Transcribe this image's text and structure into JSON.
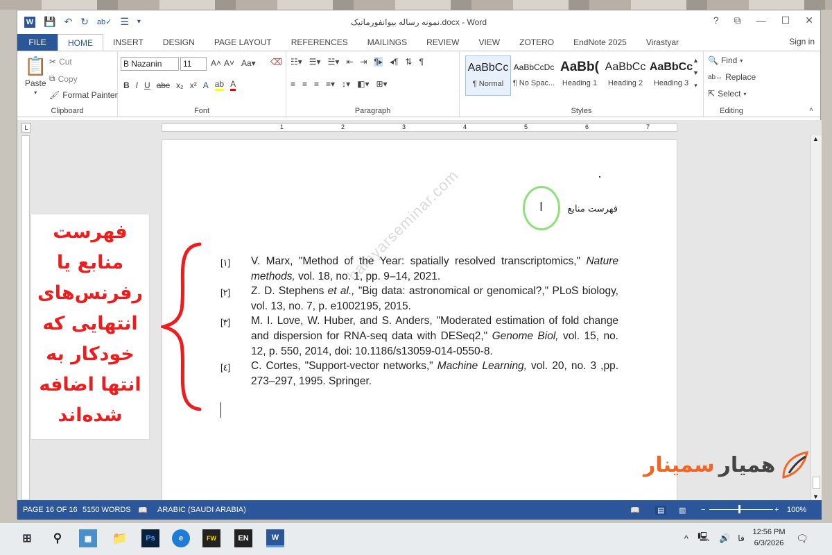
{
  "window": {
    "title": "نمونه رساله بیوانفورماتیک.docx - Word",
    "controls": [
      "?",
      "⧉",
      "—",
      "☐",
      "✕"
    ],
    "sign_in": "Sign in"
  },
  "tabs": [
    "FILE",
    "HOME",
    "INSERT",
    "DESIGN",
    "PAGE LAYOUT",
    "REFERENCES",
    "MAILINGS",
    "REVIEW",
    "VIEW",
    "ZOTERO",
    "EndNote 2025",
    "Virastyar"
  ],
  "ribbon": {
    "clipboard": {
      "paste": "Paste",
      "cut": "Cut",
      "copy": "Copy",
      "format_painter": "Format Painter",
      "label": "Clipboard"
    },
    "font": {
      "name": "B Nazanin",
      "size": "11",
      "label": "Font"
    },
    "paragraph": {
      "label": "Paragraph"
    },
    "styles": {
      "label": "Styles",
      "items": [
        {
          "preview": "AaBbCc",
          "name": "¶ Normal"
        },
        {
          "preview": "AaBbCcDc",
          "name": "¶ No Spac..."
        },
        {
          "preview": "AaBb(",
          "name": "Heading 1"
        },
        {
          "preview": "AaBbCc",
          "name": "Heading 2"
        },
        {
          "preview": "AaBbCc",
          "name": "Heading 3"
        }
      ]
    },
    "editing": {
      "find": "Find",
      "replace": "Replace",
      "select": "Select",
      "label": "Editing"
    }
  },
  "ruler": {
    "numbers": [
      "1",
      "2",
      "3",
      "4",
      "5",
      "6",
      "7"
    ]
  },
  "document": {
    "heading": "فهرست منابع",
    "watermark": "hamyarseminar.com",
    "references": [
      {
        "num": "[۱]",
        "pre": "V. Marx, \"Method of the Year: spatially resolved transcriptomics,\" ",
        "journal": "Nature methods,",
        "post": " vol. 18, no. 1, pp. 9–14, 2021."
      },
      {
        "num": "[۲]",
        "pre": "Z. D. Stephens ",
        "journal": "et al.,",
        "post": " \"Big data: astronomical or genomical?,\" PLoS biology, vol. 13, no. 7, p. e1002195, 2015."
      },
      {
        "num": "[۳]",
        "pre": "M. I. Love, W. Huber, and S. Anders, \"Moderated estimation of fold change and dispersion for RNA-seq data with DESeq2,\" ",
        "journal": "Genome Biol,",
        "post": " vol. 15, no. 12, p. 550, 2014, doi: 10.1186/s13059-014-0550-8."
      },
      {
        "num": "[٤]",
        "pre": "C. Cortes, \"Support-vector networks,\" ",
        "journal": "Machine Learning,",
        "post": " vol. 20, no. 3 ,pp. 273–297, 1995. Springer."
      }
    ]
  },
  "callout": {
    "text": "فهرست منابع یا رفرنس‌های انتهایی که خودکار به انتها اضافه شده‌اند"
  },
  "logo": {
    "word1": "همیار",
    "word2": "سمینار"
  },
  "statusbar": {
    "page": "PAGE 16 OF 16",
    "words": "5150 WORDS",
    "language": "ARABIC (SAUDI ARABIA)",
    "zoom": "100%"
  },
  "taskbar": {
    "time": "12:56 PM",
    "date": "6/3/2026",
    "lang": "فا",
    "apps": [
      "Ps",
      "EN",
      "W"
    ]
  },
  "colors": {
    "word_blue": "#2b579a",
    "callout_red": "#ee1c1c",
    "logo_orange": "#f26522"
  }
}
